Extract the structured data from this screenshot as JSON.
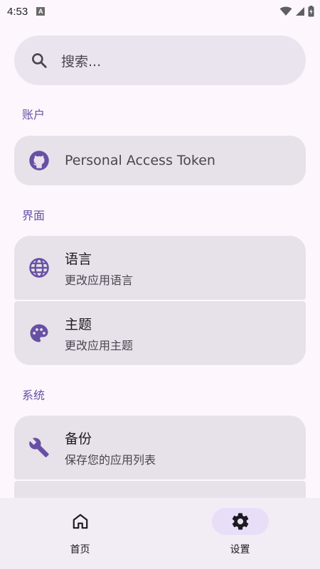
{
  "status_bar": {
    "time": "4:53",
    "notification_glyph": "A"
  },
  "search": {
    "placeholder": "搜索..."
  },
  "sections": {
    "account": {
      "title": "账户",
      "items": [
        {
          "title": "Personal Access Token",
          "icon": "github-icon"
        }
      ]
    },
    "interface": {
      "title": "界面",
      "items": [
        {
          "title": "语言",
          "subtitle": "更改应用语言",
          "icon": "globe-icon"
        },
        {
          "title": "主题",
          "subtitle": "更改应用主题",
          "icon": "palette-icon"
        }
      ]
    },
    "system": {
      "title": "系统",
      "items": [
        {
          "title": "备份",
          "subtitle": "保存您的应用列表",
          "icon": "wrench-icon"
        }
      ]
    }
  },
  "bottom_nav": {
    "items": [
      {
        "label": "首页",
        "icon": "home-icon",
        "active": false
      },
      {
        "label": "设置",
        "icon": "gear-icon",
        "active": true
      }
    ]
  },
  "colors": {
    "accent": "#6750a4",
    "card": "#e7e2ea",
    "background": "#fdf7fd",
    "nav_active": "#e8def8"
  }
}
